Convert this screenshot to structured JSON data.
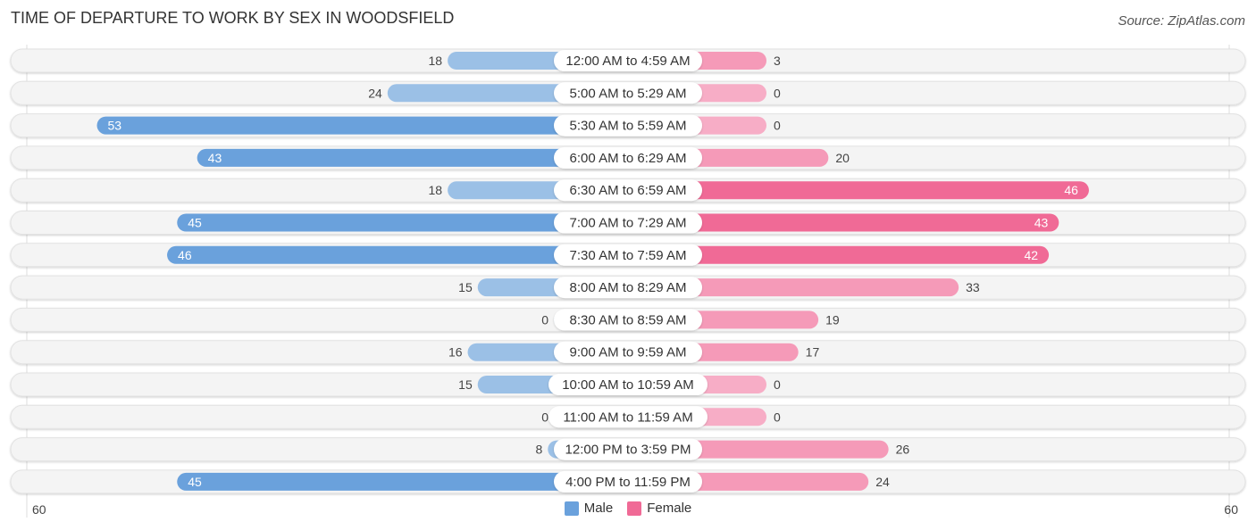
{
  "header": {
    "title": "TIME OF DEPARTURE TO WORK BY SEX IN WOODSFIELD",
    "source": "Source: ZipAtlas.com"
  },
  "colors": {
    "male_strong": "#6aa1dc",
    "male_light": "#9bc0e6",
    "female_strong": "#f06a96",
    "female_light": "#f59ab8",
    "row_bg": "#f3f3f3"
  },
  "legend": {
    "male": "Male",
    "female": "Female"
  },
  "axis": {
    "left_label": "60",
    "right_label": "60"
  },
  "chart_data": {
    "type": "bar",
    "orientation": "horizontal-diverging",
    "title": "TIME OF DEPARTURE TO WORK BY SEX IN WOODSFIELD",
    "xlabel": "",
    "ylabel": "",
    "xlim": [
      -60,
      60
    ],
    "legend_position": "bottom",
    "categories": [
      "12:00 AM to 4:59 AM",
      "5:00 AM to 5:29 AM",
      "5:30 AM to 5:59 AM",
      "6:00 AM to 6:29 AM",
      "6:30 AM to 6:59 AM",
      "7:00 AM to 7:29 AM",
      "7:30 AM to 7:59 AM",
      "8:00 AM to 8:29 AM",
      "8:30 AM to 8:59 AM",
      "9:00 AM to 9:59 AM",
      "10:00 AM to 10:59 AM",
      "11:00 AM to 11:59 AM",
      "12:00 PM to 3:59 PM",
      "4:00 PM to 11:59 PM"
    ],
    "series": [
      {
        "name": "Male",
        "values": [
          18,
          24,
          53,
          43,
          18,
          45,
          46,
          15,
          0,
          16,
          15,
          0,
          8,
          45
        ]
      },
      {
        "name": "Female",
        "values": [
          3,
          0,
          0,
          20,
          46,
          43,
          42,
          33,
          19,
          17,
          0,
          0,
          26,
          24
        ]
      }
    ]
  }
}
